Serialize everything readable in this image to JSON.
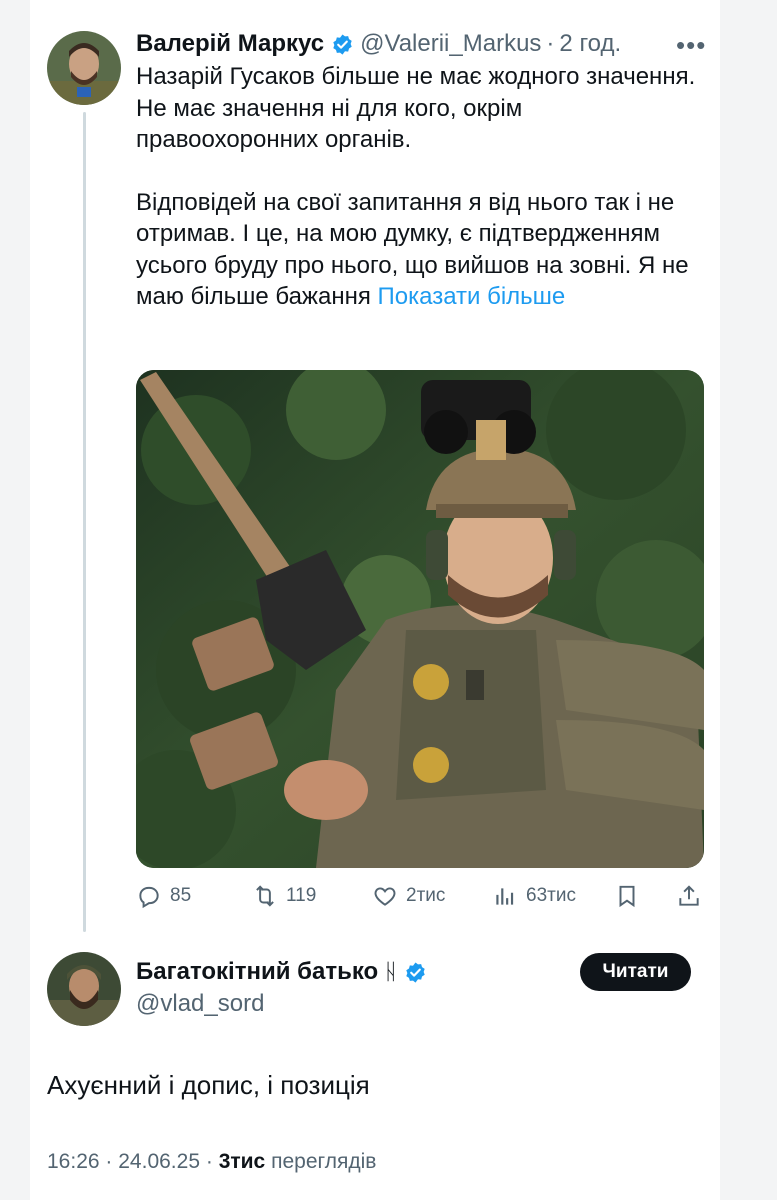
{
  "tweet": {
    "author_name": "Валерій Маркус",
    "author_handle": "@Valerii_Markus",
    "separator": "·",
    "time_ago": "2 год.",
    "paragraph1": "Назарій Гусаков більше не має жодного значення. Не має значення ні для кого, окрім правоохоронних органів.",
    "paragraph2": "Відповідей на свої запитання я від нього так і не отримав. І це, на мою думку, є підтвердженням усього бруду про нього, що вийшов на зовні. Я не маю більше бажання",
    "show_more": "Показати більше",
    "more_icon": "more-dots-icon",
    "verified_color": "#1d9bf0",
    "link_color": "#1d9bf0"
  },
  "actions": {
    "replies": "85",
    "reposts": "119",
    "likes": "2тис",
    "views": "63тис",
    "icons": [
      "reply-icon",
      "repost-icon",
      "like-icon",
      "views-icon",
      "bookmark-icon",
      "share-icon"
    ]
  },
  "quote_author": {
    "name": "Багатокітний батько",
    "rune": "ᚺ",
    "handle": "@vlad_sord",
    "follow_label": "Читати"
  },
  "reply": {
    "text": "Ахуєнний і допис, і позиція",
    "time": "16:26",
    "date": "24.06.25",
    "sep": "·",
    "views_count": "3тис",
    "views_label": "переглядів"
  }
}
